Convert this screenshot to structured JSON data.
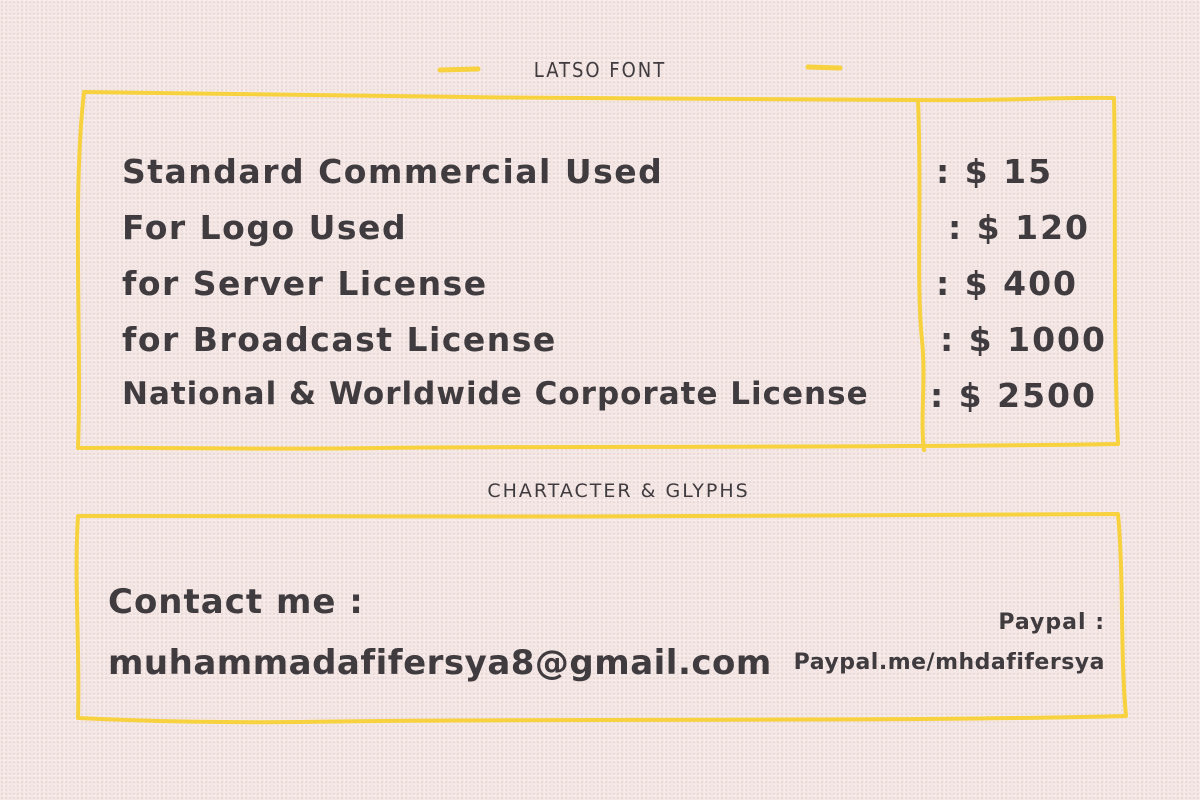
{
  "header": {
    "title": "LATSO FONT"
  },
  "licenses": [
    {
      "name": "Standard Commercial Used",
      "price": ": $ 15"
    },
    {
      "name": "For Logo Used",
      "price": ": $ 120"
    },
    {
      "name": "for Server License",
      "price": ": $ 400"
    },
    {
      "name": "for Broadcast License",
      "price": ": $ 1000"
    },
    {
      "name": "National & Worldwide Corporate License",
      "price": ": $ 2500"
    }
  ],
  "section": {
    "title": "CHARTACTER & GLYPHS"
  },
  "contact": {
    "label": "Contact me :",
    "email": "muhammadafifersya8@gmail.com",
    "paypal_label": "Paypal :",
    "paypal_link": "Paypal.me/mhdafifersya"
  },
  "colors": {
    "frame": "#f7d23e",
    "text": "#3f3b3f",
    "background": "#f3e7e5"
  }
}
